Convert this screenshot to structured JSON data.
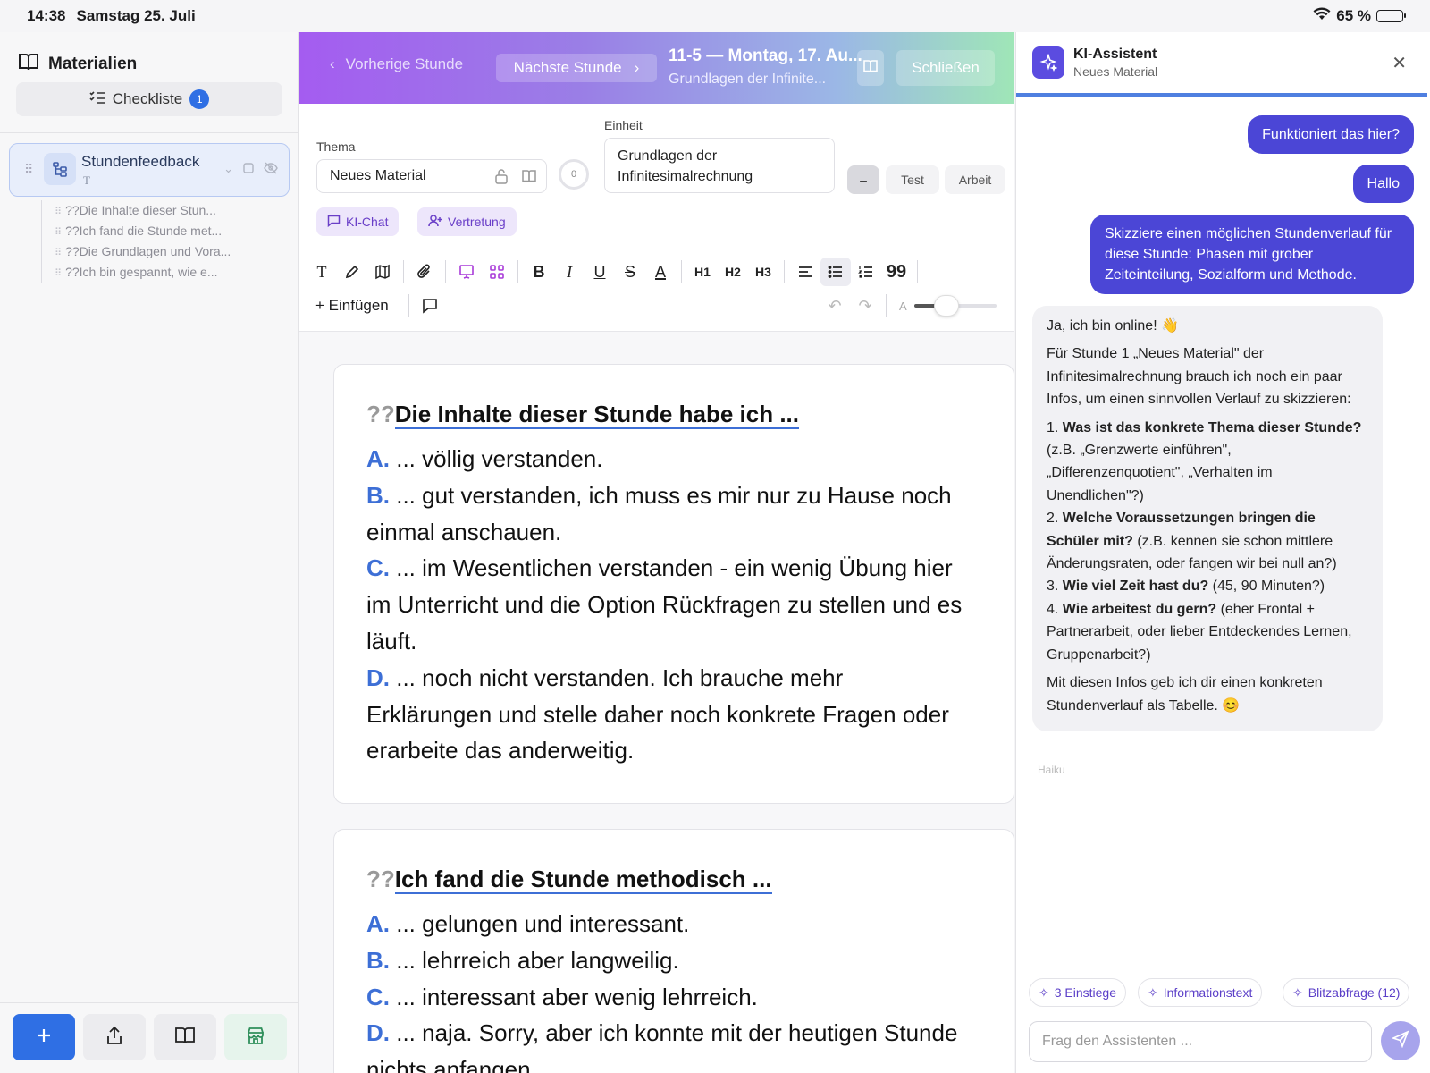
{
  "status": {
    "time": "14:38",
    "date": "Samstag 25. Juli",
    "battery": "65 %",
    "battery_level": 0.65
  },
  "sidebar": {
    "title": "Materialien",
    "checklist_label": "Checkliste",
    "checklist_count": "1",
    "item": {
      "label": "Stundenfeedback",
      "sub": "T"
    },
    "subitems": [
      "??Die Inhalte dieser Stun...",
      "??Ich fand die Stunde met...",
      "??Die Grundlagen und Vora...",
      "??Ich bin gespannt, wie e..."
    ]
  },
  "header": {
    "prev_label": "Vorherige Stunde",
    "next_label": "Nächste Stunde",
    "title": "11-5 — Montag, 17. Au...",
    "subtitle": "Grundlagen der Infinite...",
    "close_label": "Schließen"
  },
  "form": {
    "thema_label": "Thema",
    "thema_value": "Neues Material",
    "counter": "0",
    "einheit_label": "Einheit",
    "einheit_line1": "Grundlagen der",
    "einheit_line2": "Infinitesimalrechnung",
    "dash_label": "–",
    "test_label": "Test",
    "arbeit_label": "Arbeit",
    "ki_chat_label": "KI-Chat",
    "vertretung_label": "Vertretung"
  },
  "toolbar": {
    "insert_label": "+ Einfügen",
    "h1": "H1",
    "h2": "H2",
    "h3": "H3",
    "size_label": "A"
  },
  "cards": [
    {
      "prefix": "??",
      "title": "Die Inhalte dieser Stunde habe ich ...",
      "answers": [
        {
          "letter": "A.",
          "text": " ... völlig verstanden."
        },
        {
          "letter": "B.",
          "text": " ... gut verstanden, ich muss es mir nur zu Hause noch einmal anschauen."
        },
        {
          "letter": "C.",
          "text": " ... im Wesentlichen verstanden - ein wenig Übung hier im Unterricht und die Option Rückfragen zu stellen und es läuft."
        },
        {
          "letter": "D.",
          "text": " ... noch nicht verstanden. Ich brauche mehr Erklärungen und stelle daher noch konkrete Fragen oder erarbeite das anderweitig."
        }
      ]
    },
    {
      "prefix": "??",
      "title": "Ich fand die Stunde methodisch ...",
      "answers": [
        {
          "letter": "A.",
          "text": " ... gelungen und interessant."
        },
        {
          "letter": "B.",
          "text": " ... lehrreich aber langweilig."
        },
        {
          "letter": "C.",
          "text": " ... interessant aber wenig lehrreich."
        },
        {
          "letter": "D.",
          "text": " ... naja. Sorry, aber ich konnte mit der heutigen Stunde nichts anfangen."
        }
      ]
    }
  ],
  "assistant": {
    "title": "KI-Assistent",
    "subtitle": "Neues Material",
    "user_msgs": [
      "Funktioniert das hier?",
      "Hallo",
      "Skizziere einen möglichen Stundenverlauf für diese Stunde: Phasen mit grober Zeiteinteilung, Sozialform und Methode."
    ],
    "reply": {
      "greeting": "Ja, ich bin online! 👋",
      "intro": "Für Stunde 1 „Neues Material\" der Infinitesimalrechnung brauch ich noch ein paar Infos, um einen sinnvollen Verlauf zu skizzieren:",
      "q1_num": "1. ",
      "q1_bold": "Was ist das konkrete Thema dieser Stunde?",
      "q1_rest": " (z.B. „Grenzwerte einführen\", „Differenzenquotient\", „Verhalten im Unendlichen\"?)",
      "q2_num": "2. ",
      "q2_bold": "Welche Voraussetzungen bringen die Schüler mit?",
      "q2_rest": " (z.B. kennen sie schon mittlere Änderungsraten, oder fangen wir bei null an?)",
      "q3_num": "3. ",
      "q3_bold": "Wie viel Zeit hast du?",
      "q3_rest": " (45, 90 Minuten?)",
      "q4_num": "4. ",
      "q4_bold": "Wie arbeitest du gern?",
      "q4_rest": " (eher Frontal + Partnerarbeit, oder lieber Entdeckendes Lernen, Gruppenarbeit?)",
      "outro": "Mit diesen Infos geb ich dir einen konkreten Stundenverlauf als Tabelle. 😊"
    },
    "model_label": "Haiku",
    "chips": [
      "3 Einstiege",
      "Informationstext",
      "Blitzabfrage (12)"
    ],
    "input_placeholder": "Frag den Assistenten ..."
  }
}
